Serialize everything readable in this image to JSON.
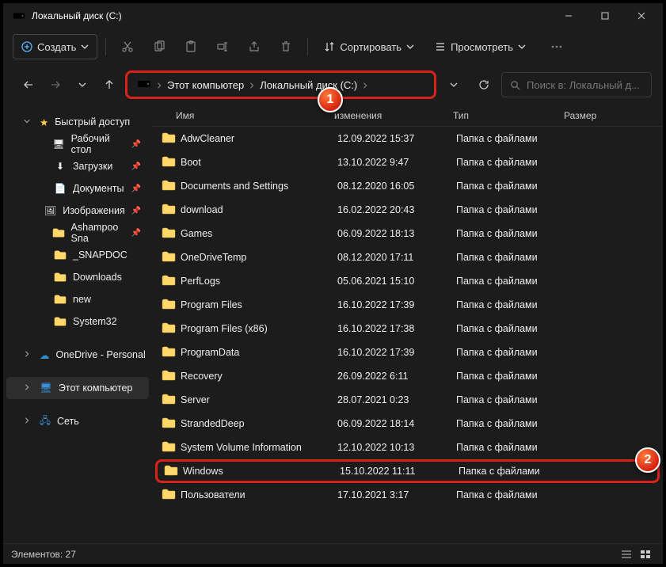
{
  "title": "Локальный диск (C:)",
  "toolbar": {
    "new": "Создать",
    "sort": "Сортировать",
    "view": "Просмотреть"
  },
  "breadcrumb": {
    "root": "Этот компьютер",
    "drive": "Локальный диск (C:)"
  },
  "search_placeholder": "Поиск в: Локальный д...",
  "sidebar": {
    "quick": "Быстрый доступ",
    "items": [
      {
        "label": "Рабочий стол",
        "pinned": true,
        "icon": "desktop"
      },
      {
        "label": "Загрузки",
        "pinned": true,
        "icon": "downloads"
      },
      {
        "label": "Документы",
        "pinned": true,
        "icon": "documents"
      },
      {
        "label": "Изображения",
        "pinned": true,
        "icon": "pictures"
      },
      {
        "label": "Ashampoo Sna",
        "pinned": true,
        "icon": "folder"
      },
      {
        "label": "_SNAPDOC",
        "pinned": false,
        "icon": "folder"
      },
      {
        "label": "Downloads",
        "pinned": false,
        "icon": "folder"
      },
      {
        "label": "new",
        "pinned": false,
        "icon": "folder"
      },
      {
        "label": "System32",
        "pinned": false,
        "icon": "folder"
      }
    ],
    "onedrive": "OneDrive - Personal",
    "thispc": "Этот компьютер",
    "network": "Сеть"
  },
  "columns": {
    "name": "Имя",
    "date": "изменения",
    "type": "Тип",
    "size": "Размер"
  },
  "folders": [
    {
      "name": "AdwCleaner",
      "date": "12.09.2022 15:37",
      "type": "Папка с файлами"
    },
    {
      "name": "Boot",
      "date": "13.10.2022 9:47",
      "type": "Папка с файлами"
    },
    {
      "name": "Documents and Settings",
      "date": "08.12.2020 16:05",
      "type": "Папка с файлами"
    },
    {
      "name": "download",
      "date": "16.02.2022 20:43",
      "type": "Папка с файлами"
    },
    {
      "name": "Games",
      "date": "06.09.2022 18:13",
      "type": "Папка с файлами"
    },
    {
      "name": "OneDriveTemp",
      "date": "08.12.2020 17:11",
      "type": "Папка с файлами"
    },
    {
      "name": "PerfLogs",
      "date": "05.06.2021 15:10",
      "type": "Папка с файлами"
    },
    {
      "name": "Program Files",
      "date": "16.10.2022 17:39",
      "type": "Папка с файлами"
    },
    {
      "name": "Program Files (x86)",
      "date": "16.10.2022 17:38",
      "type": "Папка с файлами"
    },
    {
      "name": "ProgramData",
      "date": "16.10.2022 17:39",
      "type": "Папка с файлами"
    },
    {
      "name": "Recovery",
      "date": "26.09.2022 6:11",
      "type": "Папка с файлами"
    },
    {
      "name": "Server",
      "date": "28.07.2021 0:23",
      "type": "Папка с файлами"
    },
    {
      "name": "StrandedDeep",
      "date": "06.09.2022 18:14",
      "type": "Папка с файлами"
    },
    {
      "name": "System Volume Information",
      "date": "12.10.2022 10:13",
      "type": "Папка с файлами"
    },
    {
      "name": "Windows",
      "date": "15.10.2022 11:11",
      "type": "Папка с файлами",
      "highlight": true
    },
    {
      "name": "Пользователи",
      "date": "17.10.2021 3:17",
      "type": "Папка с файлами"
    }
  ],
  "status": {
    "count_label": "Элементов:",
    "count": "27"
  },
  "badges": {
    "one": "1",
    "two": "2"
  }
}
